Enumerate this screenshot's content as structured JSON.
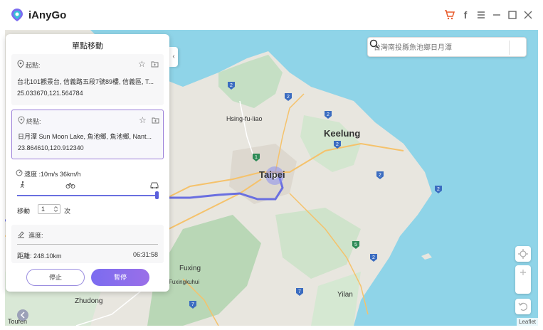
{
  "app": {
    "title": "iAnyGo"
  },
  "map": {
    "search_placeholder": "台灣南投縣魚池鄉日月潭",
    "labels": {
      "hsing_fu_liao": "Hsing-fu-liao",
      "keelung": "Keelung",
      "taipei": "Taipei",
      "fuxing": "Fuxing",
      "fuxingkuhui": "Fuxingkuhui",
      "zhudong": "Zhudong",
      "yilan": "Yilan",
      "toufen": "Toufen"
    },
    "route_markers": [
      "2",
      "2",
      "2",
      "2",
      "1",
      "2",
      "5",
      "2",
      "7",
      "7",
      "2"
    ],
    "attribution": "Leaflet"
  },
  "panel": {
    "title": "單點移動",
    "start": {
      "label": "起點:",
      "address": "台北101觀景台, 信義路五段7號89樓, 信義區, T...",
      "coords": "25.033670,121.564784"
    },
    "end": {
      "label": "終點:",
      "address": "日月潭 Sun Moon Lake, 魚池鄉, 魚池鄉, Nant...",
      "coords": "23.864610,120.912340"
    },
    "speed": {
      "label": "速度 :10m/s   36km/h"
    },
    "move": {
      "label": "移動",
      "value": "1",
      "unit": "次"
    },
    "progress": {
      "label": "進度:",
      "distance": "距離: 248.10km",
      "time": "06:31:58"
    },
    "buttons": {
      "stop": "停止",
      "pause": "暫停"
    }
  },
  "colors": {
    "accent": "#7b6cf0",
    "route": "#6a6fe0",
    "map_land": "#e8e6df",
    "map_sea": "#8fd4e8"
  }
}
